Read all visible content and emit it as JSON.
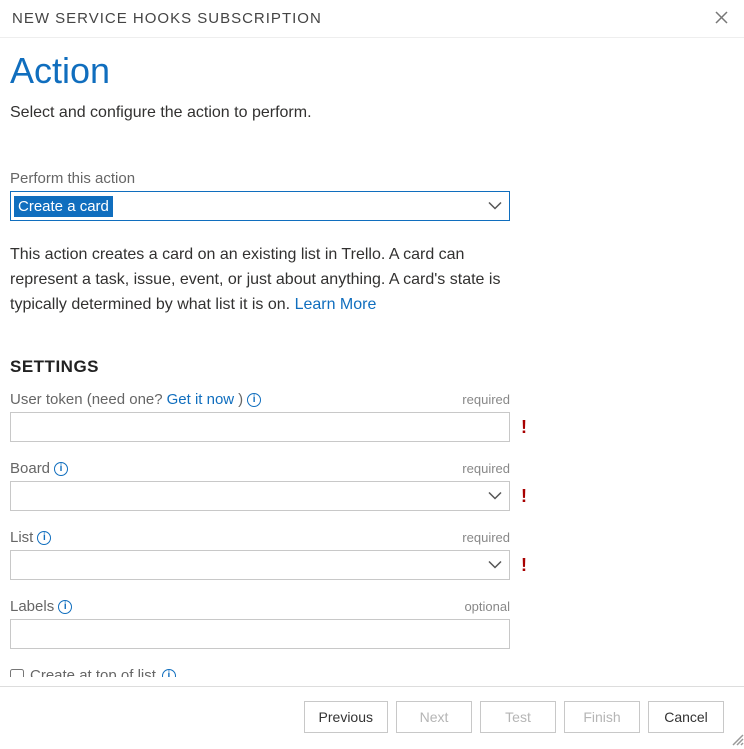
{
  "dialog": {
    "title": "NEW SERVICE HOOKS SUBSCRIPTION"
  },
  "page": {
    "heading": "Action",
    "sub": "Select and configure the action to perform."
  },
  "action_select": {
    "label": "Perform this action",
    "value": "Create a card"
  },
  "description": {
    "text": "This action creates a card on an existing list in Trello. A card can represent a task, issue, event, or just about anything. A card's state is typically determined by what list it is on. ",
    "learn_more": "Learn More"
  },
  "settings": {
    "heading": "SETTINGS",
    "user_token": {
      "label_pre": "User token (need one? ",
      "link": "Get it now",
      "label_post": ")",
      "tag": "required",
      "value": "",
      "error": true
    },
    "board": {
      "label": "Board",
      "tag": "required",
      "value": "",
      "error": true
    },
    "list": {
      "label": "List",
      "tag": "required",
      "value": "",
      "error": true
    },
    "labels": {
      "label": "Labels",
      "tag": "optional",
      "value": "",
      "error": false
    },
    "create_top": {
      "label": "Create at top of list",
      "checked": false
    }
  },
  "footer": {
    "previous": "Previous",
    "next": "Next",
    "test": "Test",
    "finish": "Finish",
    "cancel": "Cancel"
  }
}
